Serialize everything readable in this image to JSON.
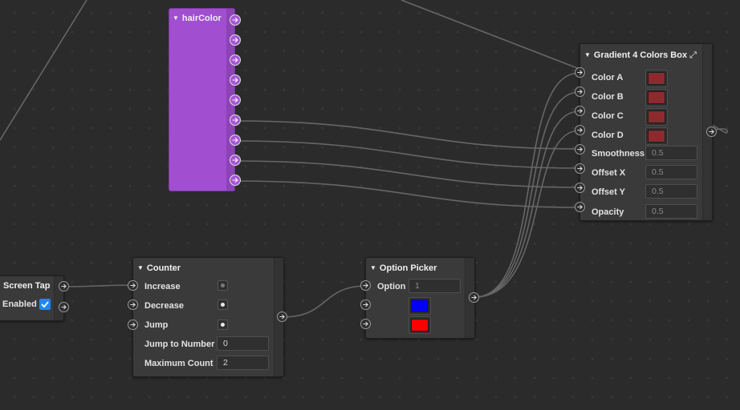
{
  "hair_color": {
    "title": "hairColor"
  },
  "gradient": {
    "title": "Gradient 4 Colors Box",
    "rows": [
      {
        "label": "Color A",
        "color": "#8c2b2e"
      },
      {
        "label": "Color B",
        "color": "#8c2b2e"
      },
      {
        "label": "Color C",
        "color": "#8c2b2e"
      },
      {
        "label": "Color D",
        "color": "#8c2b2e"
      },
      {
        "label": "Smoothness",
        "value": "0.5"
      },
      {
        "label": "Offset X",
        "value": "0.5"
      },
      {
        "label": "Offset Y",
        "value": "0.5"
      },
      {
        "label": "Opacity",
        "value": "0.5"
      }
    ]
  },
  "screen_tap": {
    "title": "Screen Tap",
    "enabled_label": "Enabled",
    "enabled": true
  },
  "counter": {
    "title": "Counter",
    "increase": "Increase",
    "decrease": "Decrease",
    "jump": "Jump",
    "jump_to_number": "Jump to Number",
    "jump_to_number_value": "0",
    "maximum_count": "Maximum Count",
    "maximum_count_value": "2"
  },
  "option_picker": {
    "title": "Option Picker",
    "option_label": "Option",
    "option_value": "1",
    "colors": [
      "#0000ff",
      "#ff0000"
    ]
  },
  "colors": {
    "hair_node": "#a14fd0",
    "checkbox": "#1f86ff",
    "wire": "#6a6a6a"
  }
}
